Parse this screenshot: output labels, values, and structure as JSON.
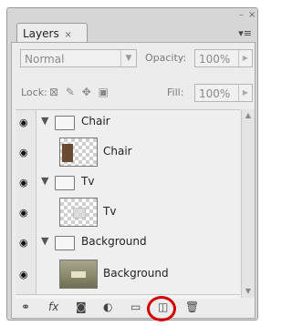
{
  "window_controls": {
    "minimize": "–",
    "close": "×"
  },
  "tab": {
    "label": "Layers",
    "close": "×"
  },
  "panel_menu": "▾≡",
  "blend_mode": {
    "value": "Normal"
  },
  "opacity": {
    "label": "Opacity:",
    "value": "100%"
  },
  "lock": {
    "label": "Lock:"
  },
  "fill": {
    "label": "Fill:",
    "value": "100%"
  },
  "layers": [
    {
      "name": "Chair",
      "kind": "group"
    },
    {
      "name": "Chair",
      "kind": "layer"
    },
    {
      "name": "Tv",
      "kind": "group"
    },
    {
      "name": "Tv",
      "kind": "layer"
    },
    {
      "name": "Background",
      "kind": "group"
    },
    {
      "name": "Background",
      "kind": "layer"
    }
  ],
  "bottom_icons": [
    "link-icon",
    "fx-icon",
    "mask-icon",
    "adjustment-icon",
    "new-group-icon",
    "new-layer-icon",
    "trash-icon"
  ],
  "highlight_target": "new-group-icon",
  "colors": {
    "highlight": "#d40000"
  }
}
